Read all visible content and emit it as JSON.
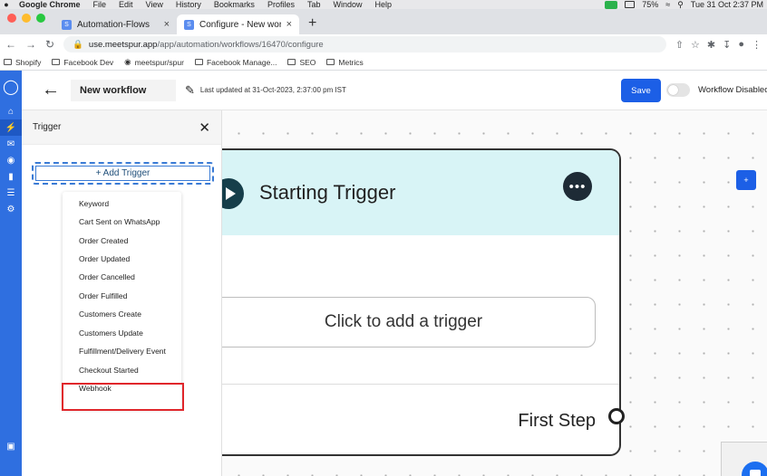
{
  "os_menubar": {
    "app_name": "Google Chrome",
    "menus": [
      "File",
      "Edit",
      "View",
      "History",
      "Bookmarks",
      "Profiles",
      "Tab",
      "Window",
      "Help"
    ],
    "battery": "75%",
    "clock": "Tue 31 Oct  2:37 PM"
  },
  "browser": {
    "tabs": [
      {
        "label": "Automation-Flows",
        "active": false
      },
      {
        "label": "Configure - New workflow",
        "active": true
      }
    ],
    "url_host": "use.meetspur.app",
    "url_path": "/app/automation/workflows/16470/configure",
    "bookmarks": [
      "Shopify",
      "Facebook Dev",
      "meetspur/spur",
      "Facebook Manage...",
      "SEO",
      "Metrics"
    ]
  },
  "header": {
    "back_icon": "arrow-left-icon",
    "workflow_name": "New workflow",
    "last_updated": "Last updated at 31-Oct-2023, 2:37:00 pm IST",
    "save_label": "Save",
    "workflow_status": "Workflow Disabled",
    "toggle_on": false
  },
  "panel": {
    "title": "Trigger",
    "add_trigger_label": "+ Add Trigger",
    "trigger_options": [
      "Keyword",
      "Cart Sent on WhatsApp",
      "Order Created",
      "Order Updated",
      "Order Cancelled",
      "Order Fulfilled",
      "Customers Create",
      "Customers Update",
      "Fulfillment/Delivery Event",
      "Checkout Started",
      "Webhook"
    ],
    "highlighted_option": "Webhook"
  },
  "canvas": {
    "node_title": "Starting Trigger",
    "more_label": "•••",
    "trigger_placeholder": "Click to add a trigger",
    "first_step_label": "First Step",
    "plus_label": "+"
  },
  "colors": {
    "nav_blue": "#2f6fe0",
    "primary": "#1c5fe6",
    "node_header": "#d8f4f6",
    "highlight_red": "#e0262b"
  }
}
